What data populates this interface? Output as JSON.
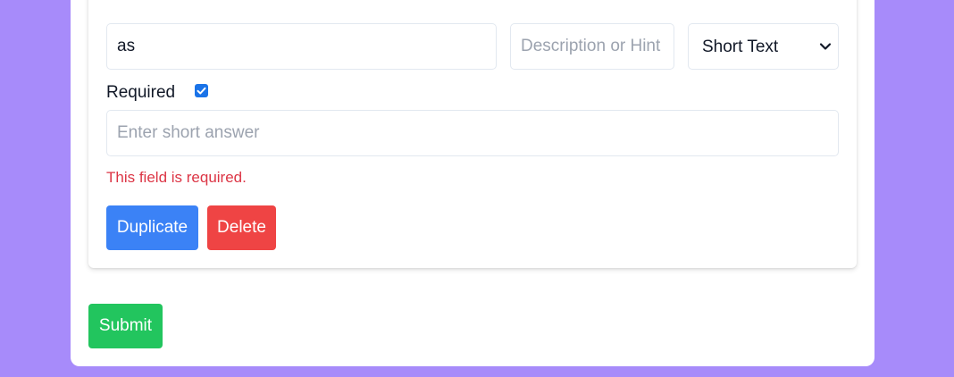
{
  "question": {
    "title_value": "as",
    "hint_placeholder": "Description or Hint",
    "type_selected": "Short Text",
    "required_label": "Required",
    "required_checked": true,
    "answer_placeholder": "Enter short answer",
    "error_message": "This field is required.",
    "duplicate_label": "Duplicate",
    "delete_label": "Delete"
  },
  "form": {
    "submit_label": "Submit"
  },
  "colors": {
    "background": "#a78bfa",
    "duplicate": "#3b82f6",
    "delete": "#ef4444",
    "submit": "#22c55e",
    "error": "#dc3545",
    "checkbox": "#1a73e8"
  },
  "icons": {
    "select": "chevron-down-icon",
    "checkbox": "checkmark-icon"
  }
}
